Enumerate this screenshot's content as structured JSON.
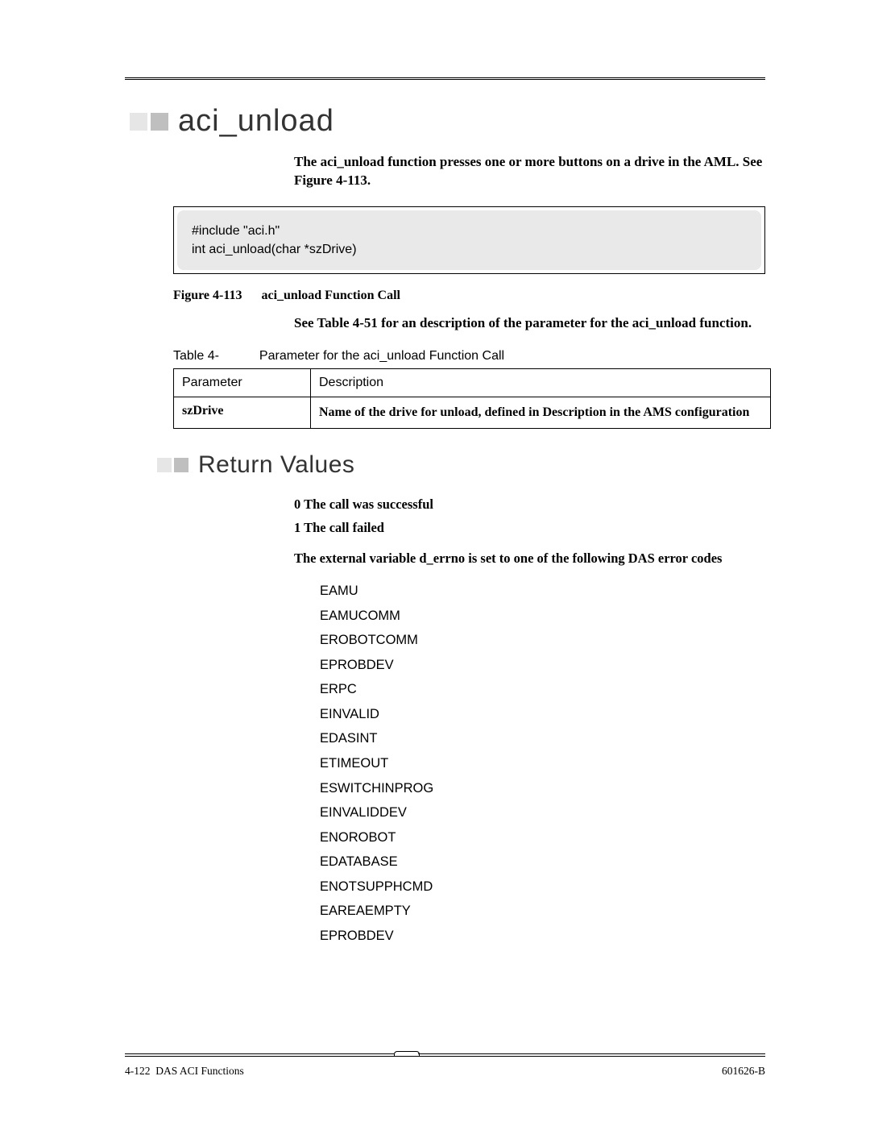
{
  "heading1": "aci_unload",
  "intro": "The aci_unload function presses one or more buttons on a drive in the AML. See Figure 4-113.",
  "code": {
    "line1": "#include \"aci.h\"",
    "line2": "int aci_unload(char *szDrive)"
  },
  "figure": {
    "label": "Figure 4-113",
    "title": "aci_unload Function Call"
  },
  "see_table": "See Table 4-51 for an description of the parameter for the aci_unload function.",
  "table_caption": {
    "label": "Table 4-",
    "title": "Parameter for the aci_unload Function Call"
  },
  "table": {
    "header_param": "Parameter",
    "header_desc": "Description",
    "row_param": "szDrive",
    "row_desc": "Name of the drive for unload, defined in Description in the AMS configuration"
  },
  "heading2": "Return Values",
  "return_values": {
    "line0": "0  The call was successful",
    "line1": "1  The call failed"
  },
  "errno_para": "The external variable d_errno is set to one of the following DAS error codes",
  "errors": [
    "EAMU",
    "EAMUCOMM",
    "EROBOTCOMM",
    "EPROBDEV",
    "ERPC",
    "EINVALID",
    "EDASINT",
    "ETIMEOUT",
    "ESWITCHINPROG",
    "EINVALIDDEV",
    "ENOROBOT",
    "EDATABASE",
    "ENOTSUPPHCMD",
    "EAREAEMPTY",
    "EPROBDEV"
  ],
  "footer": {
    "left_page": "4-122",
    "left_title": "DAS ACI Functions",
    "right": "601626-B"
  }
}
